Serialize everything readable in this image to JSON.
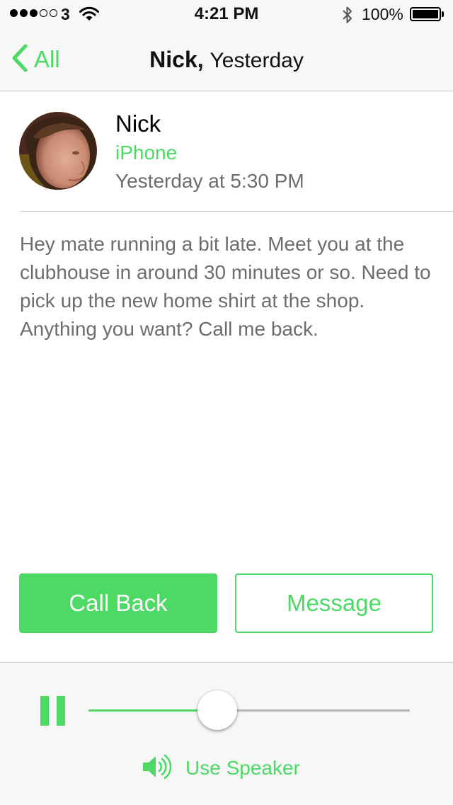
{
  "status_bar": {
    "signal_strength": 3,
    "signal_max": 5,
    "carrier": "3",
    "time": "4:21 PM",
    "battery_percent": "100%",
    "icons": [
      "signal-dots",
      "wifi-icon",
      "bluetooth-icon",
      "battery-icon"
    ]
  },
  "nav": {
    "back_label": "All",
    "title_name": "Nick,",
    "title_when": "Yesterday"
  },
  "contact": {
    "name": "Nick",
    "device": "iPhone",
    "time": "Yesterday at 5:30 PM"
  },
  "message": {
    "text": "Hey mate running a bit late. Meet you at the clubhouse in around 30 minutes or so. Need to pick up the new home shirt at the shop. Anything you want? Call me back."
  },
  "actions": {
    "call_back_label": "Call Back",
    "message_label": "Message"
  },
  "player": {
    "state": "playing",
    "progress": 0.4,
    "speaker_label": "Use Speaker"
  },
  "colors": {
    "accent": "#4cd964",
    "secondary_text": "#6d6d6d",
    "bar_background": "#f7f7f7",
    "track": "#b5b5b5"
  }
}
